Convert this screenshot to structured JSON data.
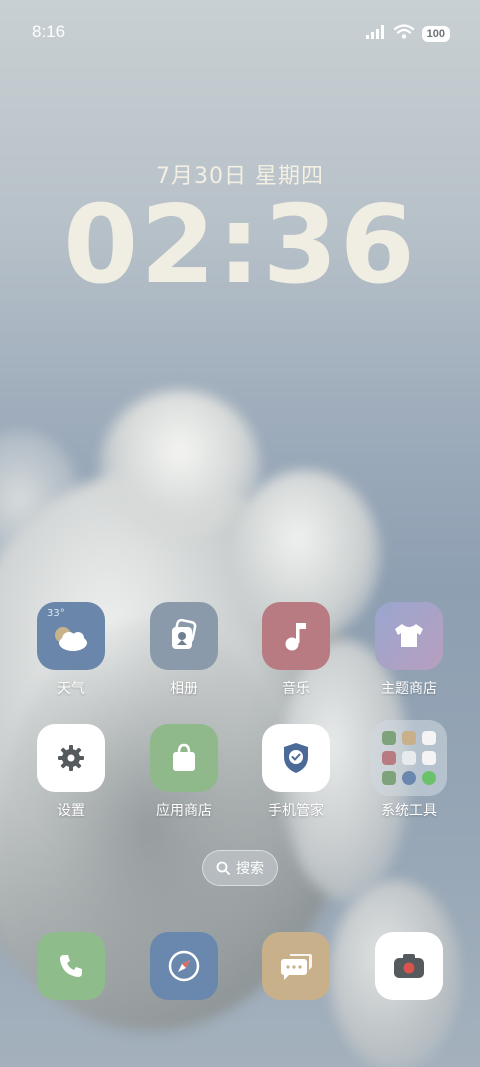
{
  "status_bar": {
    "time": "8:16",
    "battery": "100"
  },
  "lockclock": {
    "date": "7月30日 星期四",
    "time": "02:36"
  },
  "weather_widget": {
    "temp": "33°"
  },
  "apps_row1": [
    {
      "label": "天气",
      "color": "#6a87ab"
    },
    {
      "label": "相册",
      "color": "#8a9aab"
    },
    {
      "label": "音乐",
      "color": "#b87b82"
    },
    {
      "label": "主题商店",
      "color": "#a59fc7"
    }
  ],
  "apps_row2": [
    {
      "label": "设置",
      "color": "#ffffff"
    },
    {
      "label": "应用商店",
      "color": "#8fb98b"
    },
    {
      "label": "手机管家",
      "color": "#ffffff"
    },
    {
      "label": "系统工具",
      "color": "#d2dae2"
    }
  ],
  "search": {
    "label": "搜索"
  },
  "dock": [
    {
      "name": "phone",
      "color": "#8fbc8b"
    },
    {
      "name": "browser",
      "color": "#6a88ad"
    },
    {
      "name": "messages",
      "color": "#c8b08a"
    },
    {
      "name": "camera",
      "color": "#ffffff"
    }
  ]
}
